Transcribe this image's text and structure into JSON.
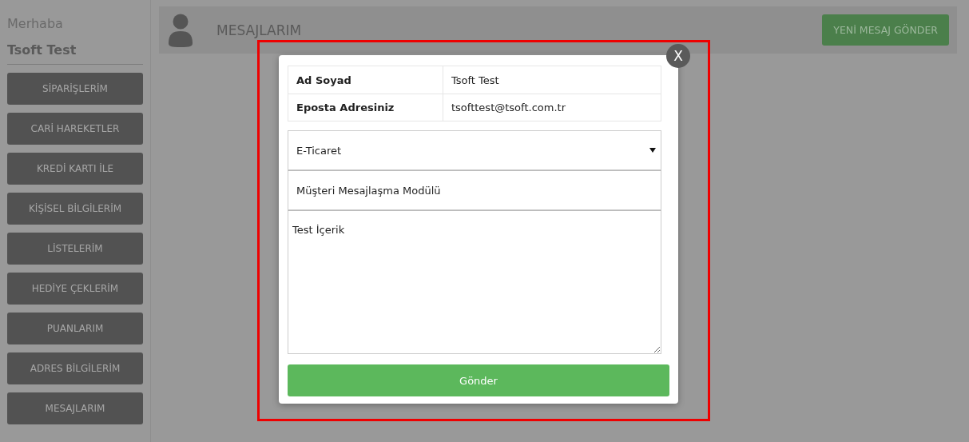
{
  "sidebar": {
    "greeting": "Merhaba",
    "user_name": "Tsoft Test",
    "items": [
      {
        "label": "SİPARİŞLERİM"
      },
      {
        "label": "CARİ HAREKETLER"
      },
      {
        "label": "KREDİ KARTI İLE"
      },
      {
        "label": "KİŞİSEL BİLGİLERİM"
      },
      {
        "label": "LİSTELERİM"
      },
      {
        "label": "HEDİYE ÇEKLERİM"
      },
      {
        "label": "PUANLARIM"
      },
      {
        "label": "ADRES BİLGİLERİM"
      },
      {
        "label": "MESAJLARIM"
      }
    ]
  },
  "header": {
    "title": "MESAJLARIM",
    "new_message_button": "YENİ MESAJ GÖNDER"
  },
  "modal": {
    "close_label": "X",
    "info_rows": [
      {
        "label": "Ad Soyad",
        "value": "Tsoft Test"
      },
      {
        "label": "Eposta Adresiniz",
        "value": "tsofttest@tsoft.com.tr"
      }
    ],
    "category_select": {
      "value": "E-Ticaret"
    },
    "subject_field": {
      "value": "Müşteri Mesajlaşma Modülü"
    },
    "message_field": {
      "value": "Test İçerik"
    },
    "submit_button": "Gönder"
  }
}
